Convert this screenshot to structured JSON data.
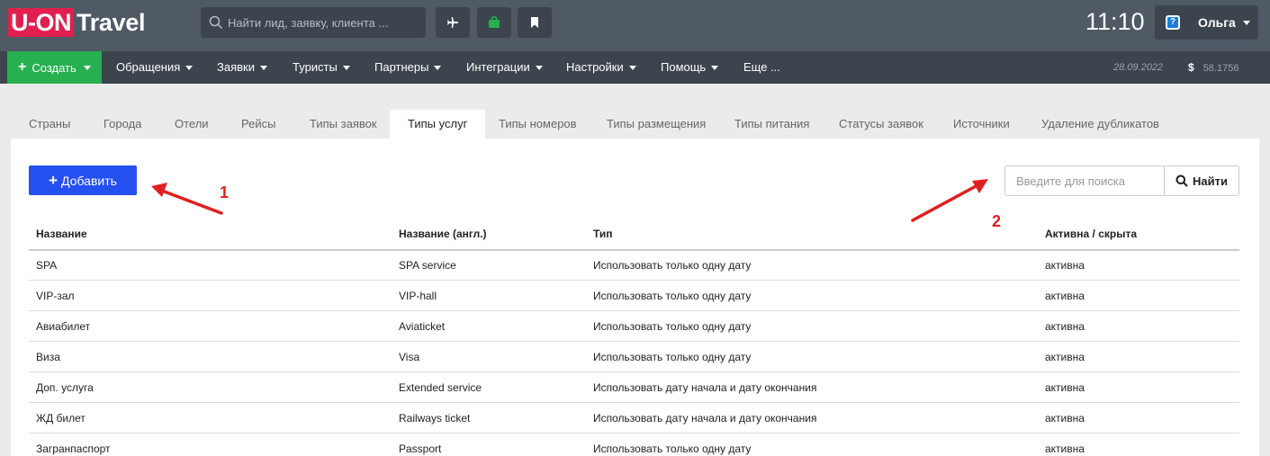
{
  "header": {
    "logo_box": "U-ON",
    "logo_text": "Travel",
    "search_placeholder": "Найти лид, заявку, клиента ...",
    "icons": [
      "plane-icon",
      "bag-icon",
      "bookmark-icon"
    ],
    "time": "11:10",
    "user_name": "Ольга",
    "accent_red": "#e01f4f"
  },
  "nav": {
    "create_label": "Создать",
    "items": [
      "Обращения",
      "Заявки",
      "Туристы",
      "Партнеры",
      "Интеграции",
      "Настройки",
      "Помощь",
      "Еще ..."
    ],
    "date": "28.09.2022",
    "currency_symbol": "$",
    "rate": "58.1756",
    "create_color": "#27b050"
  },
  "tabs": {
    "items": [
      "Страны",
      "Города",
      "Отели",
      "Рейсы",
      "Типы заявок",
      "Типы услуг",
      "Типы номеров",
      "Типы размещения",
      "Типы питания",
      "Статусы заявок",
      "Источники",
      "Удаление дубликатов"
    ],
    "active": "Типы услуг"
  },
  "toolbar": {
    "add_label": "Добавить",
    "search_placeholder": "Введите для поиска",
    "search_button": "Найти",
    "add_color": "#2450f1"
  },
  "table": {
    "columns": [
      "Название",
      "Название (англ.)",
      "Тип",
      "Активна / скрыта"
    ],
    "rows": [
      [
        "SPA",
        "SPA service",
        "Использовать только одну дату",
        "активна"
      ],
      [
        "VIP-зал",
        "VIP-hall",
        "Использовать только одну дату",
        "активна"
      ],
      [
        "Авиабилет",
        "Aviaticket",
        "Использовать только одну дату",
        "активна"
      ],
      [
        "Виза",
        "Visa",
        "Использовать только одну дату",
        "активна"
      ],
      [
        "Доп. услуга",
        "Extended service",
        "Использовать дату начала и дату окончания",
        "активна"
      ],
      [
        "ЖД билет",
        "Railways ticket",
        "Использовать дату начала и дату окончания",
        "активна"
      ],
      [
        "Загранпаспорт",
        "Passport",
        "Использовать только одну дату",
        "активна"
      ]
    ]
  },
  "annotations": {
    "label_1": "1",
    "label_2": "2",
    "arrow_color": "#e02020"
  }
}
